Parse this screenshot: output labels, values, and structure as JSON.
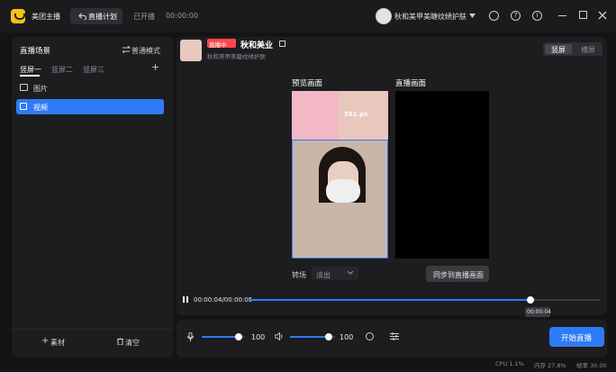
{
  "app": {
    "name": "美团主播"
  },
  "topbar": {
    "tabs": [
      {
        "label": "直播计划",
        "active": true
      },
      {
        "label": "已开播",
        "active": false
      }
    ],
    "timer": "00:00:00",
    "account_name": "秋和美甲美睫纹绣护肤"
  },
  "left_panel": {
    "title": "直播场景",
    "mode_label": "普通模式",
    "tabs": [
      "竖屏一",
      "竖屏二",
      "竖屏三"
    ],
    "add_label": "+",
    "items": [
      {
        "label": "图片",
        "icon": "image-icon",
        "active": false
      },
      {
        "label": "视频",
        "icon": "video-icon",
        "active": true
      }
    ],
    "footer": {
      "add_material": "素材",
      "clear": "清空"
    }
  },
  "header": {
    "badge": "直播中",
    "store_name": "秋和美业",
    "subtitle": "秋和美甲美睫纹绣护肤",
    "orientation": [
      "竖屏",
      "横屏"
    ],
    "orientation_active": 0
  },
  "preview": {
    "preview_title": "预览画面",
    "live_title": "直播画面",
    "overlay_text": "561 px",
    "transition_label": "转场",
    "transition_value": "淡出",
    "sync_button": "同步到直播画面"
  },
  "playback": {
    "time": "00:00:04/00:00:05",
    "progress": 0.8,
    "tooltip": "00:00:04"
  },
  "audio": {
    "mic_volume": "100",
    "mic_level": 0.85,
    "speaker_volume": "100",
    "speaker_level": 0.85
  },
  "actions": {
    "start_live": "开始直播"
  },
  "status": {
    "cpu": "CPU 1.1%",
    "memory": "内存 27.8%",
    "fps": "帧率 30.00"
  },
  "colors": {
    "accent": "#2f7bf6",
    "live_badge": "#ff4747",
    "logo": "#f7c21a"
  }
}
